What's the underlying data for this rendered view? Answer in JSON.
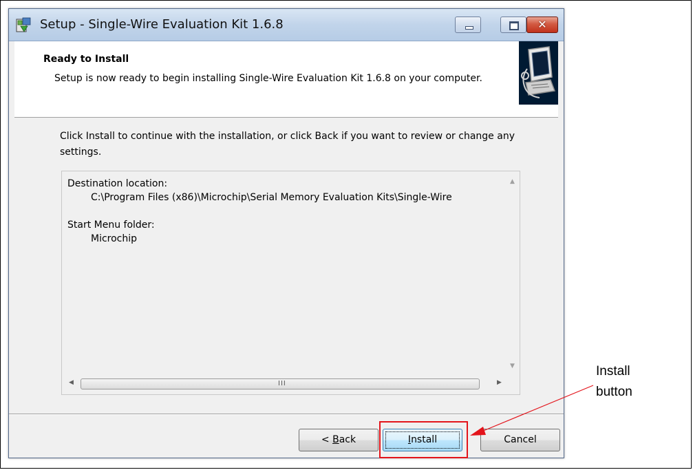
{
  "window": {
    "title": "Setup - Single-Wire Evaluation Kit 1.6.8"
  },
  "header": {
    "heading": "Ready to Install",
    "description": "Setup is now ready to begin installing Single-Wire Evaluation Kit 1.6.8 on your computer."
  },
  "body": {
    "intro": "Click Install to continue with the installation, or click Back if you want to review or change any settings.",
    "memo": {
      "dest_label": "Destination location:",
      "dest_value": "C:\\Program Files (x86)\\Microchip\\Serial Memory Evaluation Kits\\Single-Wire",
      "start_menu_label": "Start Menu folder:",
      "start_menu_value": "Microchip"
    },
    "scroll_grip": "III"
  },
  "buttons": {
    "back_prefix": "< ",
    "back_key": "B",
    "back_rest": "ack",
    "install_key": "I",
    "install_rest": "nstall",
    "cancel": "Cancel"
  },
  "annotation": {
    "line1": "Install",
    "line2": "button",
    "color": "#e3141b"
  },
  "icons": [
    "app-setup-icon",
    "minimize-icon",
    "maximize-icon",
    "close-icon",
    "computer-install-icon",
    "scroll-up-icon",
    "scroll-down-icon",
    "scroll-left-icon",
    "scroll-right-icon"
  ]
}
